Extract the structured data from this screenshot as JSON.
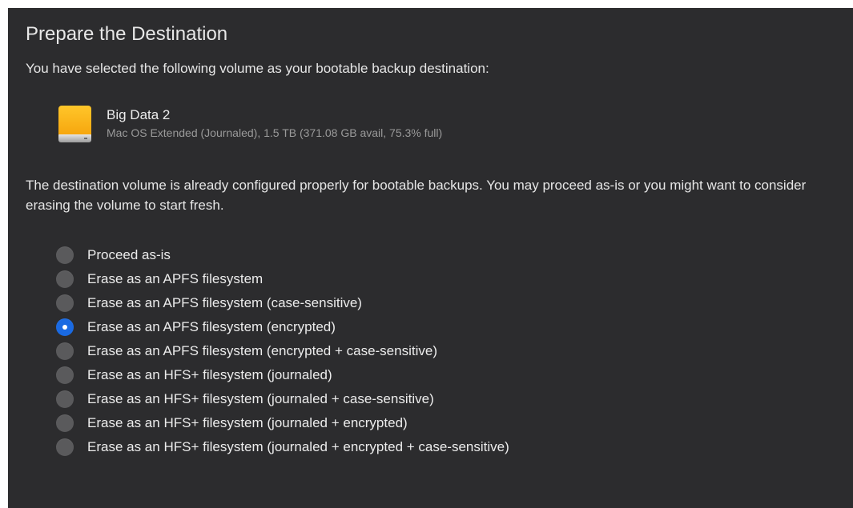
{
  "page": {
    "title": "Prepare the Destination",
    "intro": "You have selected the following volume as your bootable backup destination:",
    "status_message": "The destination volume is already configured properly for bootable backups. You may proceed as-is or you might want to consider erasing the volume to start fresh."
  },
  "volume": {
    "name": "Big Data 2",
    "details": "Mac OS Extended (Journaled), 1.5 TB (371.08 GB avail, 75.3% full)",
    "icon": "external-drive-icon"
  },
  "options": [
    {
      "label": "Proceed as-is",
      "selected": false
    },
    {
      "label": "Erase as an APFS filesystem",
      "selected": false
    },
    {
      "label": "Erase as an APFS filesystem (case-sensitive)",
      "selected": false
    },
    {
      "label": "Erase as an APFS filesystem (encrypted)",
      "selected": true
    },
    {
      "label": "Erase as an APFS filesystem (encrypted + case-sensitive)",
      "selected": false
    },
    {
      "label": "Erase as an HFS+ filesystem (journaled)",
      "selected": false
    },
    {
      "label": "Erase as an HFS+ filesystem (journaled + case-sensitive)",
      "selected": false
    },
    {
      "label": "Erase as an HFS+ filesystem (journaled + encrypted)",
      "selected": false
    },
    {
      "label": "Erase as an HFS+ filesystem (journaled + encrypted + case-sensitive)",
      "selected": false
    }
  ],
  "colors": {
    "background": "#2c2c2e",
    "accent": "#1a6ae2",
    "drive": "#f6a50d"
  }
}
